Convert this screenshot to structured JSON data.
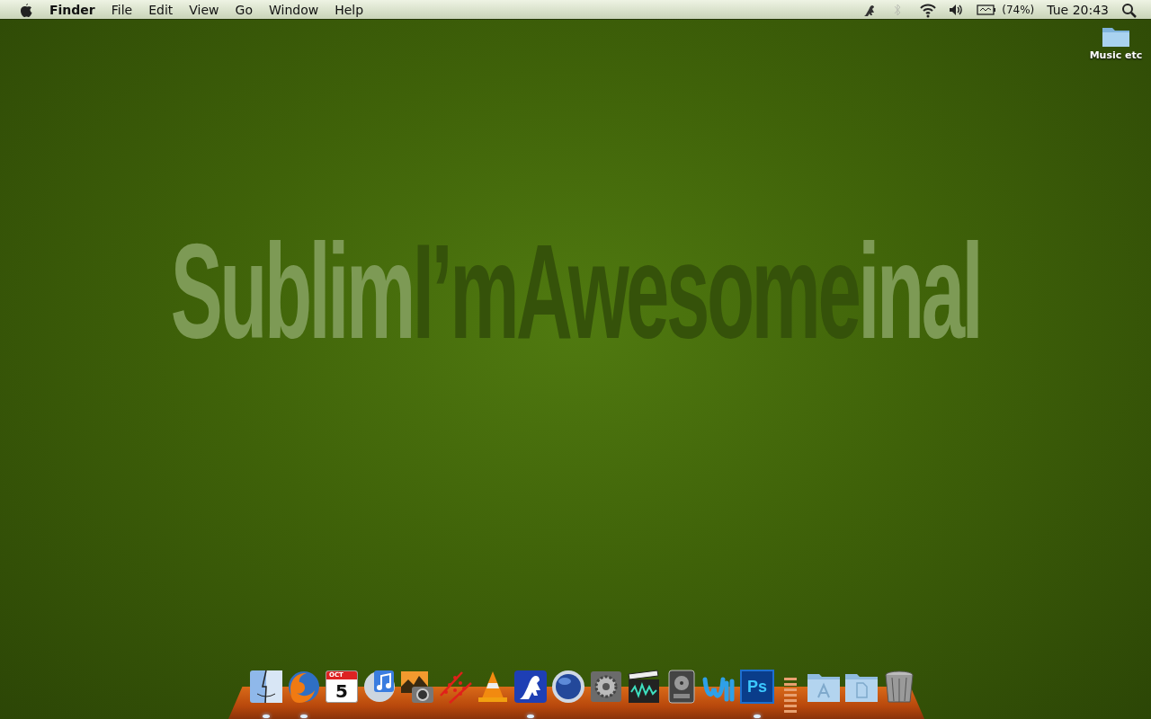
{
  "menu_bar": {
    "menus": [
      {
        "label": "Finder",
        "kind": "app"
      },
      {
        "label": "File",
        "kind": "menu"
      },
      {
        "label": "Edit",
        "kind": "menu"
      },
      {
        "label": "View",
        "kind": "menu"
      },
      {
        "label": "Go",
        "kind": "menu"
      },
      {
        "label": "Window",
        "kind": "menu"
      },
      {
        "label": "Help",
        "kind": "menu"
      }
    ],
    "status": [
      {
        "kind": "frog"
      },
      {
        "kind": "bluetooth",
        "disabled": true
      },
      {
        "kind": "wifi"
      },
      {
        "kind": "volume"
      },
      {
        "kind": "battery",
        "text": "(74%)"
      },
      {
        "kind": "clock",
        "text": "Tue 20:43"
      },
      {
        "kind": "search"
      }
    ]
  },
  "desktop_icons": [
    {
      "label": "Music etc"
    }
  ],
  "wallpaper_text": [
    {
      "text": "Sublim",
      "kind": "light"
    },
    {
      "text": "I’mAwesome",
      "kind": "dark"
    },
    {
      "text": "inal",
      "kind": "light"
    }
  ],
  "dock": {
    "items": [
      {
        "kind": "finder",
        "running": true
      },
      {
        "kind": "browser",
        "running": true
      },
      {
        "kind": "calendar",
        "running": false,
        "month": "OCT",
        "day": "5"
      },
      {
        "kind": "music",
        "running": false
      },
      {
        "kind": "photo",
        "running": false
      },
      {
        "kind": "dots",
        "running": false
      },
      {
        "kind": "cone",
        "running": false
      },
      {
        "kind": "frog",
        "running": true
      },
      {
        "kind": "globe",
        "running": false
      },
      {
        "kind": "gear",
        "running": false
      },
      {
        "kind": "clapper",
        "running": false
      },
      {
        "kind": "drive",
        "running": false
      },
      {
        "kind": "word",
        "running": false
      },
      {
        "kind": "ps",
        "running": true,
        "text": "Ps"
      },
      {
        "kind": "separator"
      },
      {
        "kind": "folder-apps",
        "running": false
      },
      {
        "kind": "folder-docs",
        "running": false
      },
      {
        "kind": "trash",
        "running": false
      }
    ]
  }
}
